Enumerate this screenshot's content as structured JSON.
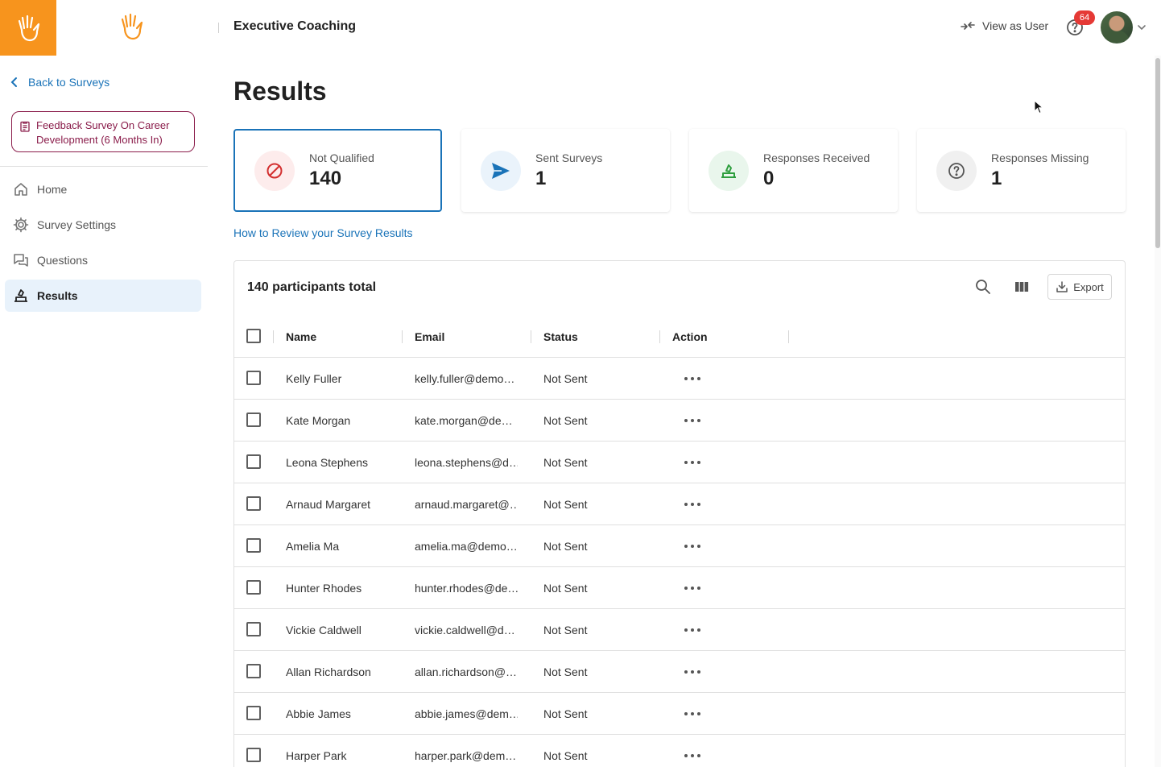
{
  "header": {
    "app_title": "Executive Coaching",
    "view_as_user": "View as User",
    "notification_count": "64"
  },
  "sidebar": {
    "back_label": "Back to Surveys",
    "survey_name": "Feedback Survey On Career Development (6 Months In)",
    "nav": [
      {
        "label": "Home",
        "icon": "home-icon",
        "active": false
      },
      {
        "label": "Survey Settings",
        "icon": "gear-icon",
        "active": false
      },
      {
        "label": "Questions",
        "icon": "chat-icon",
        "active": false
      },
      {
        "label": "Results",
        "icon": "results-icon",
        "active": true
      }
    ]
  },
  "main": {
    "title": "Results",
    "review_link": "How to Review your Survey Results",
    "stats": [
      {
        "label": "Not Qualified",
        "value": "140",
        "icon": "blocked-icon",
        "color": "#d32f2f",
        "bg": "#fdecec"
      },
      {
        "label": "Sent Surveys",
        "value": "1",
        "icon": "send-icon",
        "color": "#1a73b8",
        "bg": "#eaf3fb"
      },
      {
        "label": "Responses Received",
        "value": "0",
        "icon": "received-icon",
        "color": "#2e9e3e",
        "bg": "#e9f6ec"
      },
      {
        "label": "Responses Missing",
        "value": "1",
        "icon": "question-icon",
        "color": "#555555",
        "bg": "#f0f0f0"
      }
    ],
    "table": {
      "title": "140 participants total",
      "export_label": "Export",
      "columns": [
        "Name",
        "Email",
        "Status",
        "Action"
      ],
      "rows": [
        {
          "name": "Kelly Fuller",
          "email": "kelly.fuller@demo…",
          "status": "Not Sent"
        },
        {
          "name": "Kate Morgan",
          "email": "kate.morgan@de…",
          "status": "Not Sent"
        },
        {
          "name": "Leona Stephens",
          "email": "leona.stephens@d…",
          "status": "Not Sent"
        },
        {
          "name": "Arnaud Margaret",
          "email": "arnaud.margaret@…",
          "status": "Not Sent"
        },
        {
          "name": "Amelia Ma",
          "email": "amelia.ma@demo…",
          "status": "Not Sent"
        },
        {
          "name": "Hunter Rhodes",
          "email": "hunter.rhodes@de…",
          "status": "Not Sent"
        },
        {
          "name": "Vickie Caldwell",
          "email": "vickie.caldwell@d…",
          "status": "Not Sent"
        },
        {
          "name": "Allan Richardson",
          "email": "allan.richardson@…",
          "status": "Not Sent"
        },
        {
          "name": "Abbie James",
          "email": "abbie.james@dem…",
          "status": "Not Sent"
        },
        {
          "name": "Harper Park",
          "email": "harper.park@dem…",
          "status": "Not Sent"
        }
      ]
    }
  },
  "colors": {
    "brand_orange": "#f7941d",
    "accent_blue": "#1a73b8",
    "survey_pill": "#8a1c4a"
  }
}
